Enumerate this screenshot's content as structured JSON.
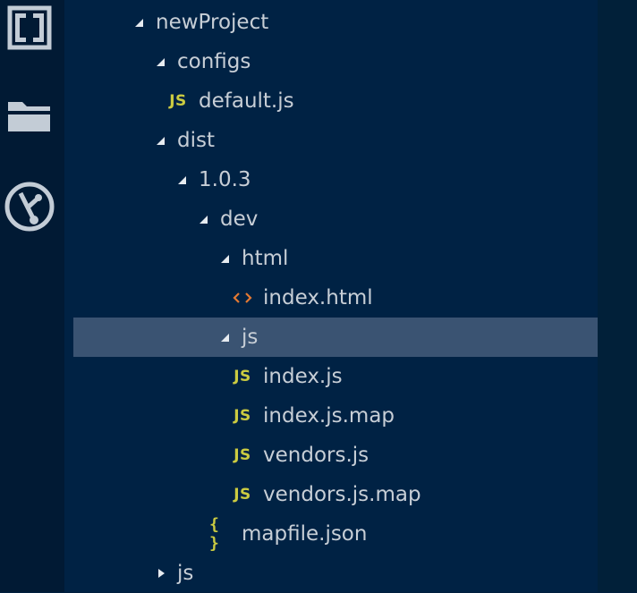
{
  "activity_bar": {
    "icons": [
      "brackets-logo-icon",
      "folder-icon",
      "git-branch-icon"
    ]
  },
  "tree": [
    {
      "label": "newProject",
      "level": 0,
      "kind": "folder",
      "expanded": true,
      "selected": false
    },
    {
      "label": "configs",
      "level": 1,
      "kind": "folder",
      "expanded": true,
      "selected": false
    },
    {
      "label": "default.js",
      "level": 2,
      "kind": "js",
      "selected": false
    },
    {
      "label": "dist",
      "level": 1,
      "kind": "folder",
      "expanded": true,
      "selected": false
    },
    {
      "label": "1.0.3",
      "level": 2,
      "kind": "folder",
      "expanded": true,
      "selected": false
    },
    {
      "label": "dev",
      "level": 3,
      "kind": "folder",
      "expanded": true,
      "selected": false
    },
    {
      "label": "html",
      "level": 4,
      "kind": "folder",
      "expanded": true,
      "selected": false
    },
    {
      "label": "index.html",
      "level": 5,
      "kind": "html",
      "selected": false
    },
    {
      "label": "js",
      "level": 4,
      "kind": "folder",
      "expanded": true,
      "selected": true
    },
    {
      "label": "index.js",
      "level": 5,
      "kind": "js",
      "selected": false
    },
    {
      "label": "index.js.map",
      "level": 5,
      "kind": "js",
      "selected": false
    },
    {
      "label": "vendors.js",
      "level": 5,
      "kind": "js",
      "selected": false
    },
    {
      "label": "vendors.js.map",
      "level": 5,
      "kind": "js",
      "selected": false
    },
    {
      "label": "mapfile.json",
      "level": 4,
      "kind": "json",
      "selected": false
    },
    {
      "label": "js",
      "level": 1,
      "kind": "folder",
      "expanded": false,
      "selected": false
    }
  ],
  "badges": {
    "js": "JS",
    "json": "{ }"
  },
  "colors": {
    "background": "#002244",
    "activity_bar": "#011a34",
    "selection": "#3a5372",
    "text": "#c7ced6",
    "js_badge": "#cbcb41",
    "html_badge": "#e37933",
    "twisty": "#e6ebf0"
  }
}
